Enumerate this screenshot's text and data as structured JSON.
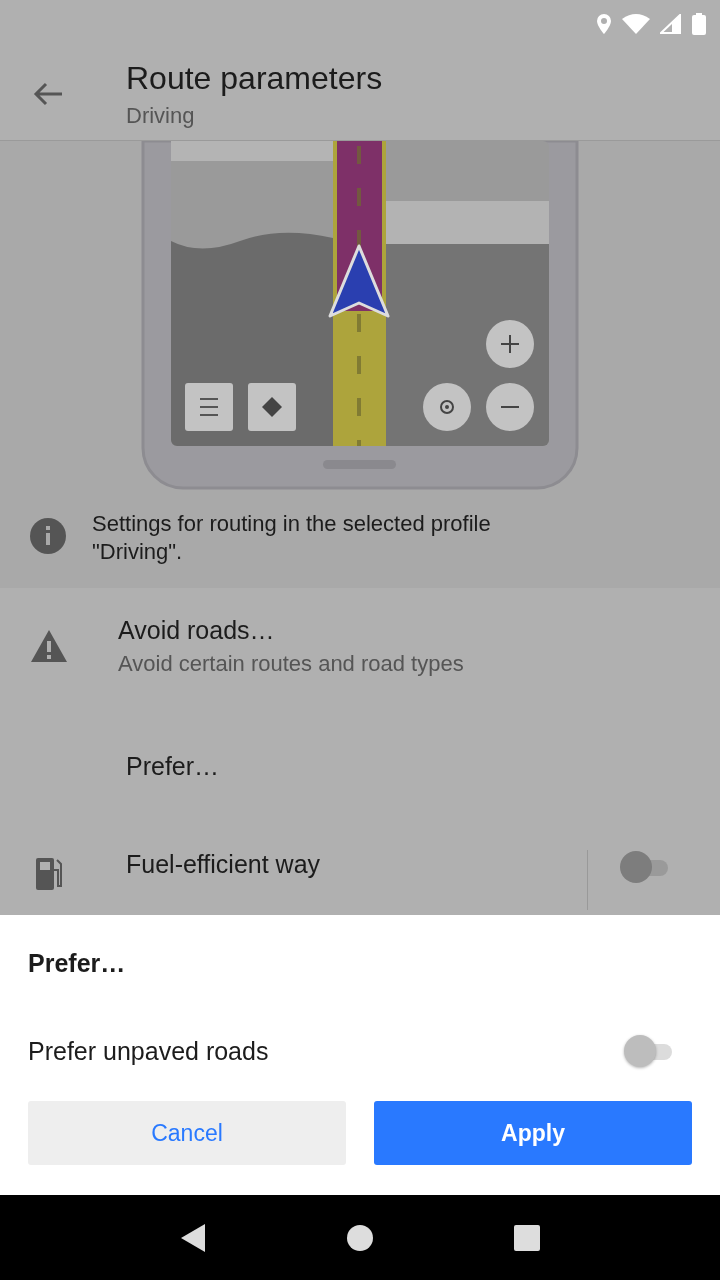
{
  "app_bar": {
    "title": "Route parameters",
    "subtitle": "Driving"
  },
  "info": {
    "text": "Settings for routing in the selected profile \"Driving\"."
  },
  "settings": [
    {
      "kind": "link",
      "title": "Avoid roads…",
      "subtitle": "Avoid certain routes and road types"
    },
    {
      "kind": "header",
      "title": "Prefer…"
    },
    {
      "kind": "switch",
      "title": "Fuel-efficient way",
      "on": false
    }
  ],
  "sheet": {
    "title": "Prefer…",
    "options": [
      {
        "label": "Prefer unpaved roads",
        "on": false
      }
    ],
    "buttons": [
      {
        "label": "Cancel",
        "kind": "secondary"
      },
      {
        "label": "Apply",
        "kind": "primary"
      }
    ]
  }
}
